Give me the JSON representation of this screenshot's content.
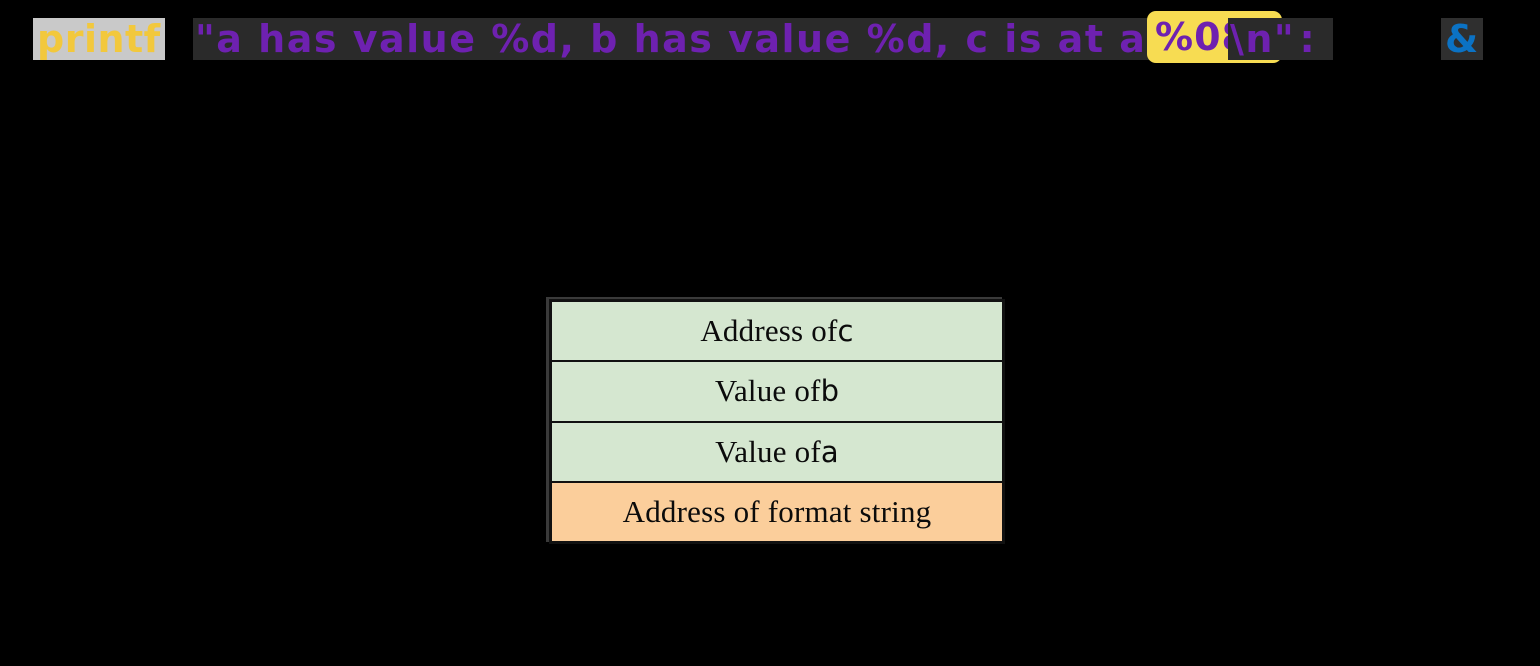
{
  "code_line": {
    "function_name": "printf",
    "string_before_highlight": "\"a has value %d, b has value %d, c is at address: ",
    "highlighted_specifier": "%08x",
    "string_after_highlight": "\\n\"",
    "ampersand": "&",
    "colors": {
      "function_name": "#F2C83C",
      "string": "#6E21B0",
      "highlight_background": "#F7DC52",
      "ampersand": "#0B72C4",
      "token_background": "#C9C9C9"
    }
  },
  "stack_diagram": {
    "rows": [
      {
        "label": "Address of ",
        "variable": "c",
        "color": "#D5E7D0",
        "kind": "green"
      },
      {
        "label": "Value of ",
        "variable": "b",
        "color": "#D5E7D0",
        "kind": "green"
      },
      {
        "label": "Value of ",
        "variable": "a",
        "color": "#D5E7D0",
        "kind": "green"
      },
      {
        "label": "Address of format string",
        "variable": "",
        "color": "#FBCE9B",
        "kind": "orange"
      }
    ]
  }
}
